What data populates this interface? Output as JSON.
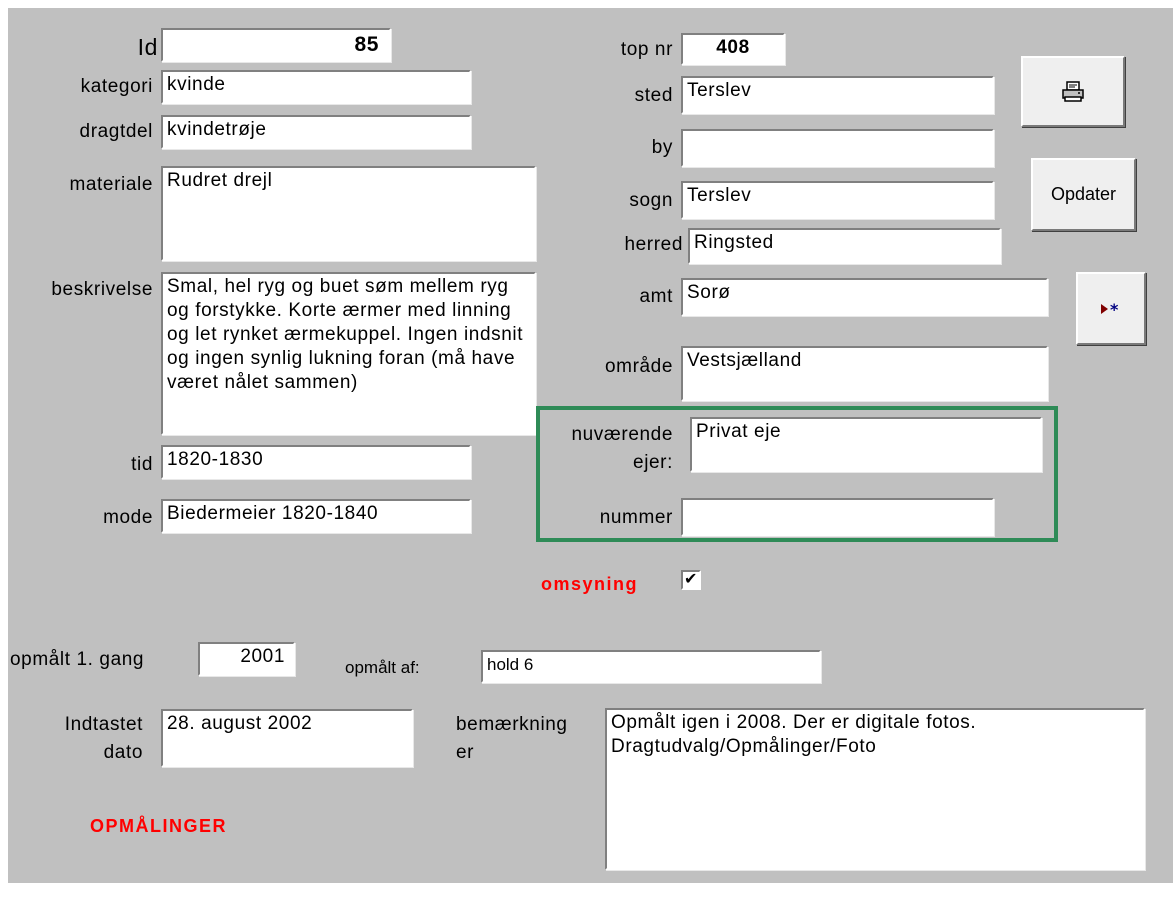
{
  "fields": {
    "id": {
      "label": "Id",
      "value": "85"
    },
    "kategori": {
      "label": "kategori",
      "value": "kvinde"
    },
    "dragtdel": {
      "label": "dragtdel",
      "value": "kvindetrøje"
    },
    "materiale": {
      "label": "materiale",
      "value": "Rudret drejl"
    },
    "beskrivelse": {
      "label": "beskrivelse",
      "value": "Smal, hel ryg og buet søm mellem ryg og forstykke. Korte ærmer med linning og let rynket ærmekuppel. Ingen indsnit og ingen synlig lukning foran (må have været nålet sammen)"
    },
    "tid": {
      "label": "tid",
      "value": "1820-1830"
    },
    "mode": {
      "label": "mode",
      "value": "Biedermeier 1820-1840"
    },
    "top_nr": {
      "label": "top nr",
      "value": "408"
    },
    "sted": {
      "label": "sted",
      "value": "Terslev"
    },
    "by": {
      "label": "by",
      "value": ""
    },
    "sogn": {
      "label": "sogn",
      "value": "Terslev"
    },
    "herred": {
      "label": "herred",
      "value": "Ringsted"
    },
    "amt": {
      "label": "amt",
      "value": "Sorø"
    },
    "omraade": {
      "label": "område",
      "value": "Vestsjælland"
    },
    "ejer": {
      "label_line1": "nuværende",
      "label_line2": "ejer:",
      "value": "Privat eje"
    },
    "nummer": {
      "label": "nummer",
      "value": ""
    },
    "omsyning": {
      "label": "omsyning",
      "checked": true,
      "mark": "✔"
    },
    "opmaalt_gang": {
      "label": "opmålt 1. gang",
      "value": "2001"
    },
    "opmaalt_af": {
      "label": "opmålt af:",
      "value": "hold 6"
    },
    "indtastet": {
      "label_line1": "Indtastet",
      "label_line2": "dato",
      "value": "28. august 2002"
    },
    "bemaerkninger": {
      "label_line1": "bemærkning",
      "label_line2": "er",
      "value": "Opmålt igen i 2008. Der er digitale fotos.\nDragtudvalg/Opmålinger/Foto"
    }
  },
  "buttons": {
    "print_icon": "printer-icon",
    "opdater": "Opdater",
    "new_record_icon": "new-record-icon"
  },
  "links": {
    "opmaalinger": "OPMÅLINGER"
  },
  "colors": {
    "form_bg": "#c0c0c0",
    "frame_green": "#2e8b57",
    "accent_red": "#ff0000",
    "nav_arrow": "#800000",
    "nav_star": "#000080"
  }
}
